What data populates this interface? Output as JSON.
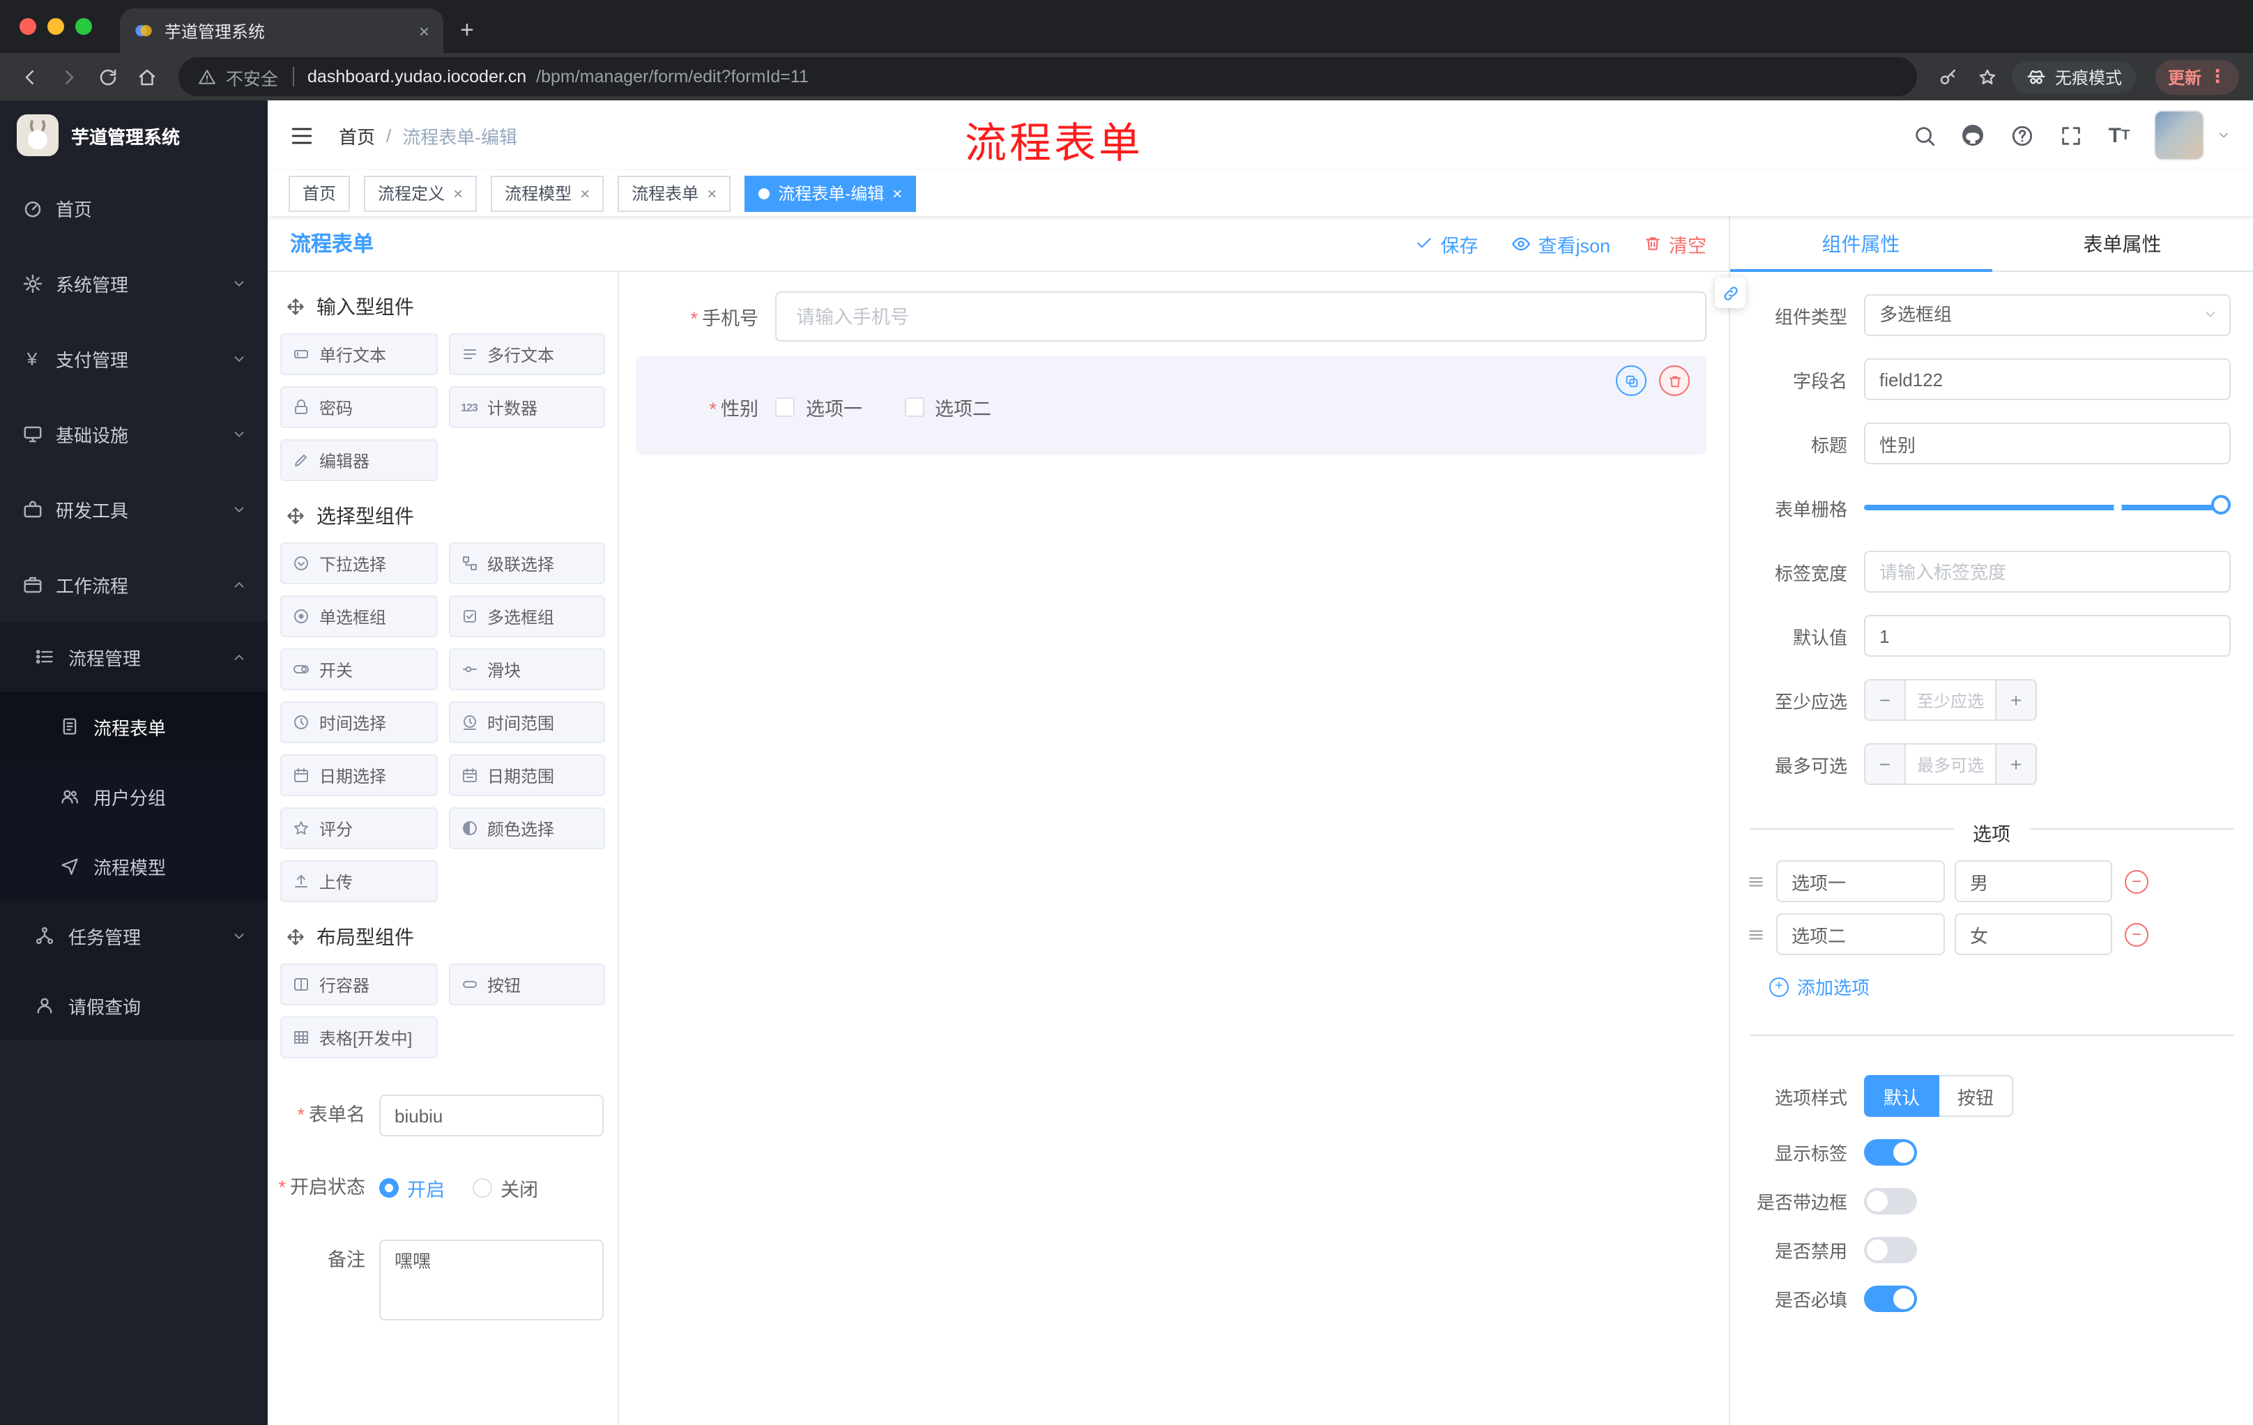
{
  "browser": {
    "tab_title": "芋道管理系统",
    "security_label": "不安全",
    "url_domain": "dashboard.yudao.iocoder.cn",
    "url_path": "/bpm/manager/form/edit?formId=11",
    "incognito_label": "无痕模式",
    "update_label": "更新"
  },
  "sidebar": {
    "title": "芋道管理系统",
    "items": [
      {
        "label": "首页"
      },
      {
        "label": "系统管理"
      },
      {
        "label": "支付管理"
      },
      {
        "label": "基础设施"
      },
      {
        "label": "研发工具"
      },
      {
        "label": "工作流程"
      },
      {
        "label": "流程管理"
      },
      {
        "label": "流程表单"
      },
      {
        "label": "用户分组"
      },
      {
        "label": "流程模型"
      },
      {
        "label": "任务管理"
      },
      {
        "label": "请假查询"
      }
    ]
  },
  "header": {
    "breadcrumb_home": "首页",
    "breadcrumb_current": "流程表单-编辑",
    "annotation": "流程表单"
  },
  "tags": [
    {
      "label": "首页"
    },
    {
      "label": "流程定义"
    },
    {
      "label": "流程模型"
    },
    {
      "label": "流程表单"
    },
    {
      "label": "流程表单-编辑"
    }
  ],
  "designer": {
    "title": "流程表单",
    "save": "保存",
    "view_json": "查看json",
    "clear": "清空"
  },
  "palette": {
    "sections": [
      {
        "title": "输入型组件",
        "items": [
          "单行文本",
          "多行文本",
          "密码",
          "计数器",
          "编辑器"
        ]
      },
      {
        "title": "选择型组件",
        "items": [
          "下拉选择",
          "级联选择",
          "单选框组",
          "多选框组",
          "开关",
          "滑块",
          "时间选择",
          "时间范围",
          "日期选择",
          "日期范围",
          "评分",
          "颜色选择",
          "上传"
        ]
      },
      {
        "title": "布局型组件",
        "items": [
          "行容器",
          "按钮",
          "表格[开发中]"
        ]
      }
    ],
    "form": {
      "name_label": "表单名",
      "name_value": "biubiu",
      "status_label": "开启状态",
      "status_on": "开启",
      "status_off": "关闭",
      "remark_label": "备注",
      "remark_value": "嘿嘿"
    }
  },
  "canvas": {
    "phone_label": "手机号",
    "phone_placeholder": "请输入手机号",
    "gender_label": "性别",
    "gender_option1": "选项一",
    "gender_option2": "选项二"
  },
  "props": {
    "tab_component": "组件属性",
    "tab_form": "表单属性",
    "component_type_label": "组件类型",
    "component_type_value": "多选框组",
    "field_name_label": "字段名",
    "field_name_value": "field122",
    "title_label": "标题",
    "title_value": "性别",
    "grid_label": "表单栅格",
    "label_width_label": "标签宽度",
    "label_width_placeholder": "请输入标签宽度",
    "default_label": "默认值",
    "default_value": "1",
    "min_label": "至少应选",
    "min_placeholder": "至少应选",
    "max_label": "最多可选",
    "max_placeholder": "最多可选",
    "options_title": "选项",
    "options": [
      {
        "label": "选项一",
        "value": "男"
      },
      {
        "label": "选项二",
        "value": "女"
      }
    ],
    "add_option": "添加选项",
    "option_style_label": "选项样式",
    "style_default": "默认",
    "style_button": "按钮",
    "show_label": "显示标签",
    "border_label": "是否带边框",
    "disabled_label": "是否禁用",
    "required_label": "是否必填"
  },
  "colors": {
    "accent": "#409eff",
    "danger": "#f56c6c"
  }
}
